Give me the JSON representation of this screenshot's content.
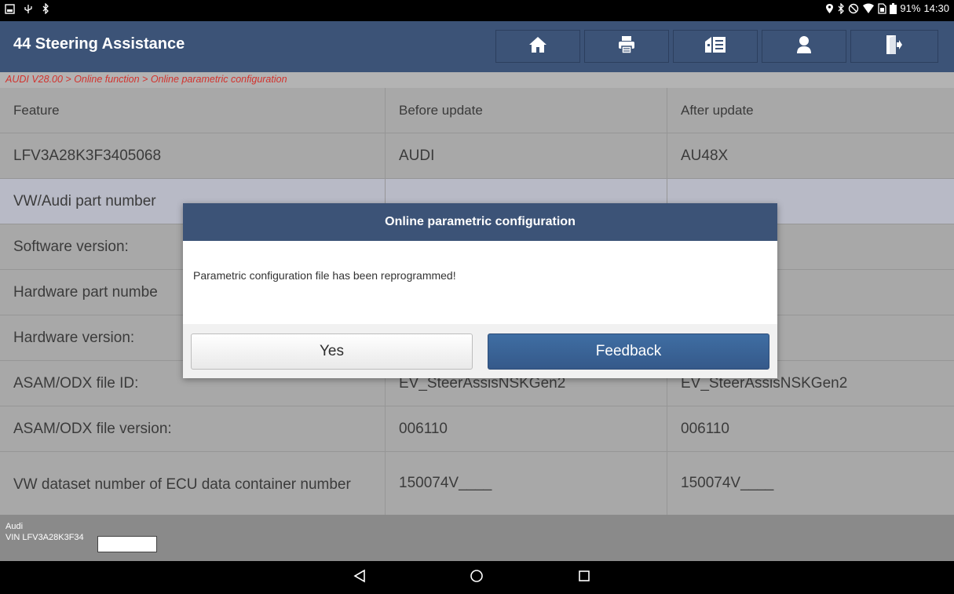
{
  "status_bar": {
    "battery_percent": "91%",
    "time": "14:30",
    "icons_left": [
      "image-icon",
      "usb-icon",
      "bluetooth-icon"
    ],
    "icons_right": [
      "location-icon",
      "bluetooth-icon",
      "do-not-disturb-icon",
      "wifi-icon",
      "sim-icon",
      "battery-icon"
    ]
  },
  "title_bar": {
    "title": "44 Steering Assistance",
    "buttons": [
      "home-icon",
      "print-icon",
      "report-icon",
      "user-icon",
      "exit-icon"
    ]
  },
  "breadcrumb": "AUDI V28.00 > Online function > Online parametric configuration",
  "table": {
    "headers": [
      "Feature",
      "Before update",
      "After update"
    ],
    "rows": [
      [
        "LFV3A28K3F3405068",
        "AUDI",
        "AU48X"
      ],
      [
        "VW/Audi part number",
        "",
        ""
      ],
      [
        "Software version:",
        "",
        ""
      ],
      [
        "Hardware part numbe",
        "",
        ""
      ],
      [
        "Hardware version:",
        "",
        ""
      ],
      [
        "ASAM/ODX file ID:",
        "EV_SteerAssisNSKGen2",
        "EV_SteerAssisNSKGen2"
      ],
      [
        "ASAM/ODX file version:",
        "006110",
        "006110"
      ],
      [
        "VW dataset number of ECU data container number",
        "150074V____",
        "150074V____"
      ]
    ]
  },
  "footer": {
    "make": "Audi",
    "vin": "VIN LFV3A28K3F34"
  },
  "dialog": {
    "title": "Online parametric configuration",
    "message": "Parametric configuration file has been reprogrammed!",
    "yes_label": "Yes",
    "feedback_label": "Feedback"
  },
  "colors": {
    "header_blue": "#3c5377",
    "breadcrumb_red": "#d2322d",
    "table_gray": "#a8a8a8",
    "highlight_row": "#b8bac6",
    "feedback_blue": "#35598a"
  }
}
